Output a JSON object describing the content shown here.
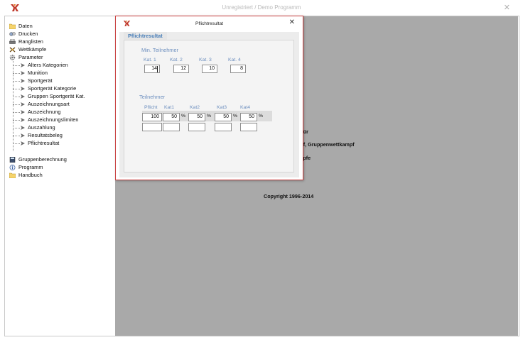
{
  "window": {
    "title": "Unregistriert  /  Demo Programm",
    "close_glyph": "✕"
  },
  "tree": [
    {
      "label": "Daten",
      "icon": "folder-icon"
    },
    {
      "label": "Drucken",
      "icon": "print-icon"
    },
    {
      "label": "Ranglisten",
      "icon": "printer-icon"
    },
    {
      "label": "Wettkämpfe",
      "icon": "crossed-swords-icon"
    },
    {
      "label": "Parameter",
      "icon": "gear-icon"
    }
  ],
  "parameter_children": [
    "Alters Kategorien",
    "Munition",
    "Sportgerät",
    "Sportgerät Kategorie",
    "Gruppen Sportgerät Kat.",
    "Auszeichnungsart",
    "Auszeichnung",
    "Auszeichnungslimiten",
    "Auszahlung",
    "Resultatsbeleg",
    "Pflichtresultat"
  ],
  "tree_bottom": [
    {
      "label": "Gruppenberechnung",
      "icon": "calculator-icon"
    },
    {
      "label": "Programm",
      "icon": "info-icon"
    },
    {
      "label": "Handbuch",
      "icon": "folder-icon"
    }
  ],
  "background_text": {
    "line1": "m für",
    "line2": "mpf, Gruppenwettkampf",
    "line3": "ämpfe",
    "copyright": "Copyright 1996-2014"
  },
  "dialog": {
    "title": "Pflichtresultat",
    "close_glyph": "✕",
    "tab": "Pflichtresultat",
    "min_section": "Min. Teilnehmer",
    "kat_labels": [
      "Kat. 1",
      "Kat. 2",
      "Kat. 3",
      "Kat. 4"
    ],
    "kat_values": [
      "14",
      "12",
      "10",
      "8"
    ],
    "teilnehmer_section": "Teilnehmer",
    "teil_headers": [
      "Pflicht",
      "Kat1",
      "Kat2",
      "Kat3",
      "Kat4"
    ],
    "teil_values": [
      "100",
      "50",
      "50",
      "50",
      "50"
    ],
    "percent": "%"
  },
  "colors": {
    "accent_blue": "#4a7fb8",
    "label_blue": "#6d8fbf",
    "dialog_border": "#c94040",
    "gray_area": "#a9a9a9"
  }
}
